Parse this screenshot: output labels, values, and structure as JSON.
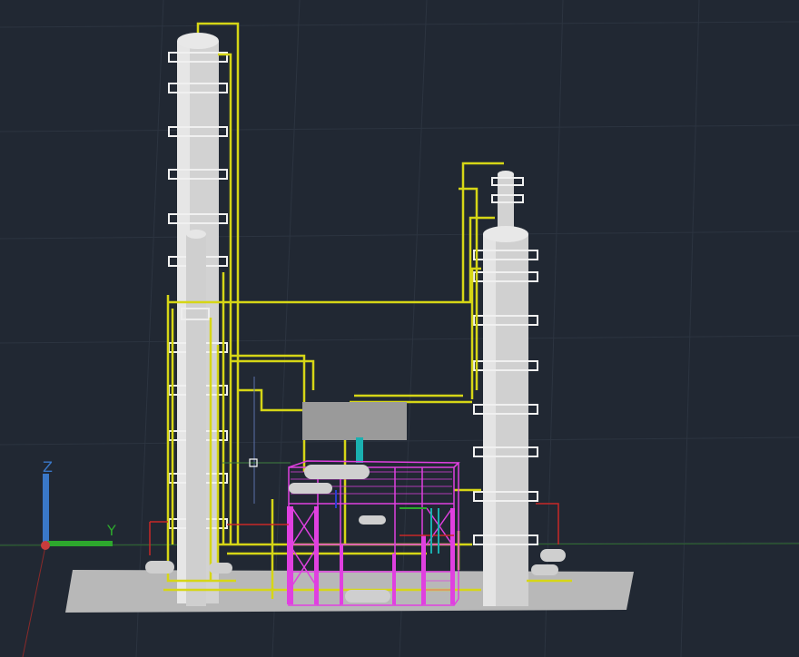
{
  "viewport": {
    "background": "#212833",
    "grid_color": "#2c3440"
  },
  "ucs": {
    "z_label": "Z",
    "y_label": "Y",
    "z_color": "#3a78c8",
    "y_color": "#2da82d",
    "origin_color": "#c83c3c"
  },
  "colors": {
    "vessel": "#d8d8d8",
    "pipe": "#d6d616",
    "structure": "#e040e0",
    "base_slab": "#b8b8b8",
    "teal": "#1ab0b0",
    "red_line": "#c82828"
  }
}
